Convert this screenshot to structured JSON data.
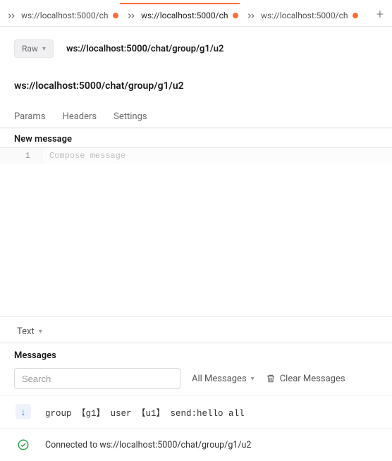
{
  "tabs": [
    {
      "label": "ws://localhost:5000/ch",
      "modified": true,
      "active": false
    },
    {
      "label": "ws://localhost:5000/ch",
      "modified": true,
      "active": true
    },
    {
      "label": "ws://localhost:5000/ch",
      "modified": true,
      "active": false
    }
  ],
  "toolbar": {
    "raw_label": "Raw",
    "url": "ws://localhost:5000/chat/group/g1/u2"
  },
  "heading_url": "ws://localhost:5000/chat/group/g1/u2",
  "subtabs": {
    "params": "Params",
    "headers": "Headers",
    "settings": "Settings"
  },
  "editor": {
    "section_label": "New message",
    "line_number": "1",
    "placeholder": "Compose message",
    "value": ""
  },
  "format_selector": {
    "label": "Text"
  },
  "messages": {
    "section_label": "Messages",
    "search_placeholder": "Search",
    "filter_label": "All Messages",
    "clear_label": "Clear Messages",
    "rows": [
      {
        "kind": "incoming",
        "text": "group 【g1】 user 【u1】 send:hello all"
      },
      {
        "kind": "connected",
        "text": "Connected to ws://localhost:5000/chat/group/g1/u2"
      }
    ]
  }
}
